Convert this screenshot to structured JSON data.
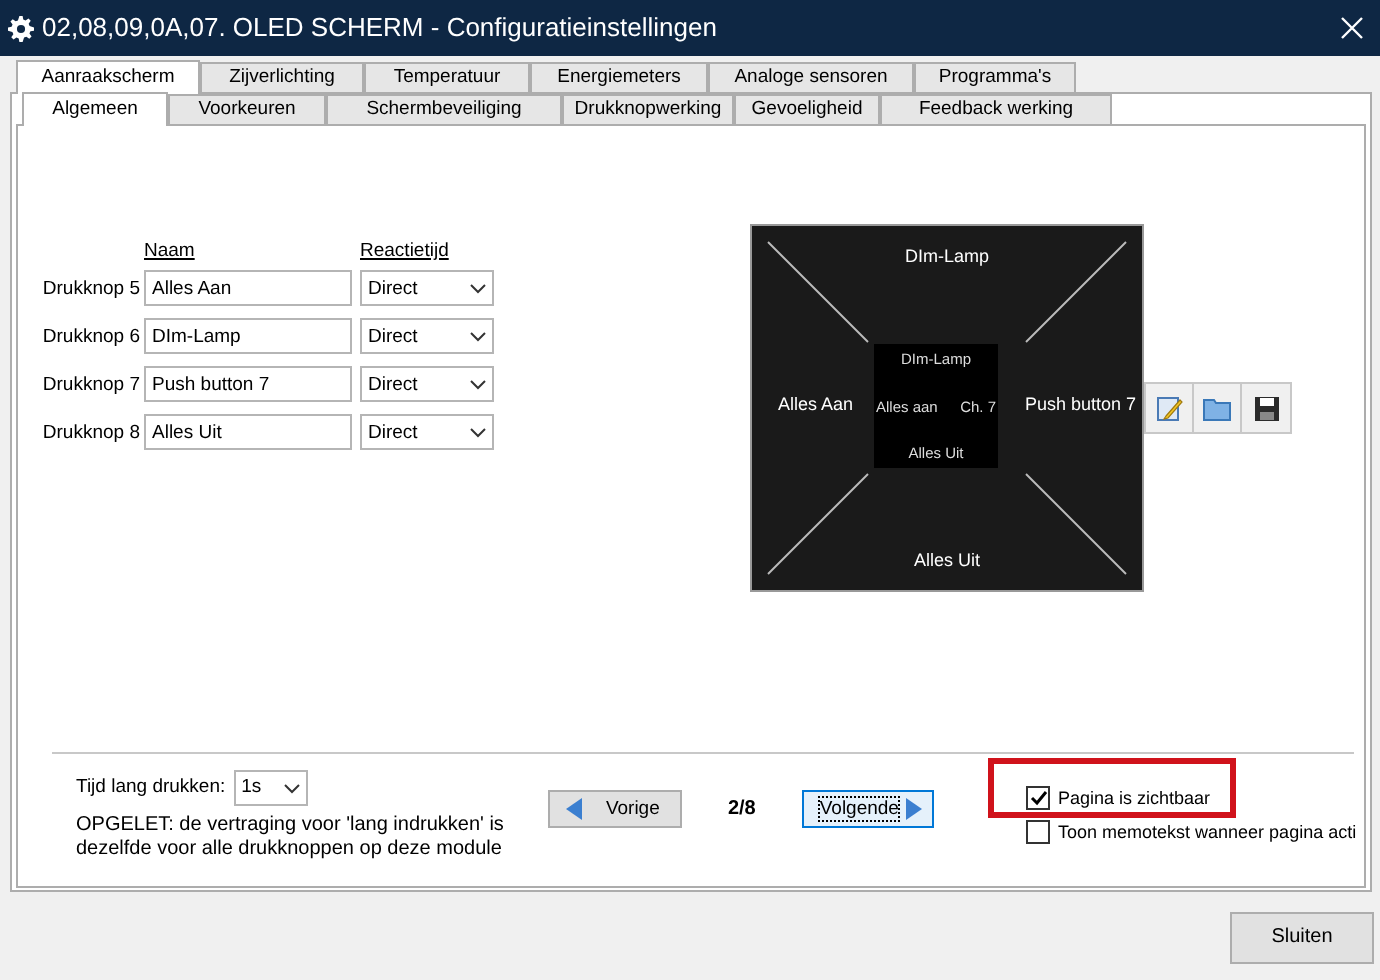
{
  "window": {
    "title": "02,08,09,0A,07. OLED SCHERM - Configuratieinstellingen"
  },
  "tabs": [
    {
      "label": "Aanraakscherm",
      "selected": true
    },
    {
      "label": "Zijverlichting",
      "selected": false
    },
    {
      "label": "Temperatuur",
      "selected": false
    },
    {
      "label": "Energiemeters",
      "selected": false
    },
    {
      "label": "Analoge sensoren",
      "selected": false
    },
    {
      "label": "Programma's",
      "selected": false
    }
  ],
  "subtabs": [
    {
      "label": "Algemeen",
      "selected": true
    },
    {
      "label": "Voorkeuren",
      "selected": false
    },
    {
      "label": "Schermbeveiliging",
      "selected": false
    },
    {
      "label": "Drukknopwerking",
      "selected": false
    },
    {
      "label": "Gevoeligheid",
      "selected": false
    },
    {
      "label": "Feedback werking",
      "selected": false
    }
  ],
  "buttons_table": {
    "columns": [
      "Naam",
      "Reactietijd"
    ],
    "rows": [
      {
        "label": "Drukknop 5",
        "name": "Alles Aan",
        "reaction": "Direct"
      },
      {
        "label": "Drukknop 6",
        "name": "DIm-Lamp",
        "reaction": "Direct"
      },
      {
        "label": "Drukknop 7",
        "name": "Push button 7",
        "reaction": "Direct"
      },
      {
        "label": "Drukknop 8",
        "name": "Alles Uit",
        "reaction": "Direct"
      }
    ]
  },
  "preview": {
    "top": "DIm-Lamp",
    "left": "Alles Aan",
    "right": "Push button 7",
    "bottom": "Alles Uit",
    "center": {
      "top": "DIm-Lamp",
      "left": "Alles aan",
      "right": "Ch. 7",
      "bottom": "Alles Uit"
    }
  },
  "long_press": {
    "label": "Tijd lang drukken:",
    "value": "1s",
    "warning_lines": [
      "OPGELET: de vertraging voor 'lang indrukken' is",
      "dezelfde voor alle drukknoppen op deze module"
    ]
  },
  "pager": {
    "previous": "Vorige",
    "page": "2/8",
    "next": "Volgende",
    "next_focused": true
  },
  "options": [
    {
      "label": "Pagina is zichtbaar",
      "checked": true,
      "highlighted": true
    },
    {
      "label": "Toon memotekst wanneer pagina acti",
      "checked": false,
      "highlighted": false
    }
  ],
  "close_button": "Sluiten"
}
